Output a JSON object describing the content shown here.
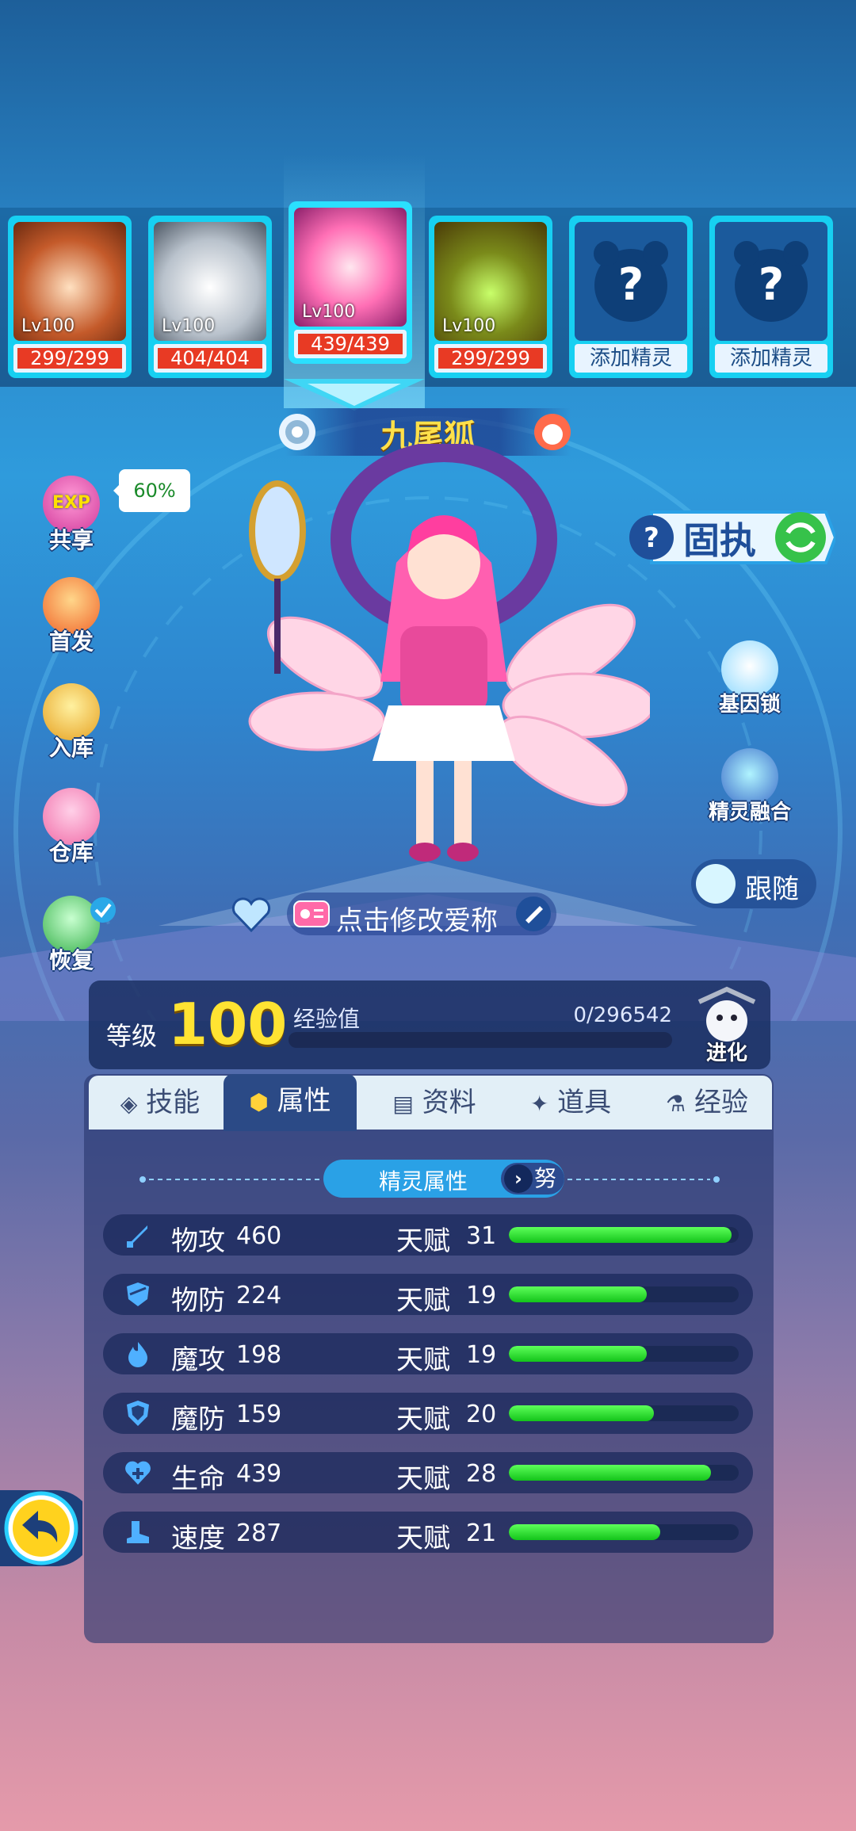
{
  "team": [
    {
      "level": "Lv100",
      "hp": "299/299"
    },
    {
      "level": "Lv100",
      "hp": "404/404"
    },
    {
      "level": "Lv100",
      "hp": "439/439",
      "selected": true
    },
    {
      "level": "Lv100",
      "hp": "299/299"
    },
    {
      "add_label": "添加精灵"
    },
    {
      "add_label": "添加精灵"
    }
  ],
  "pet": {
    "name": "九尾狐",
    "nickname_prompt": "点击修改爱称",
    "trait": "固执",
    "follow_label": "跟随"
  },
  "left_menu": {
    "exp_share": {
      "label": "共享",
      "badge": "EXP",
      "percent": "60%"
    },
    "first": {
      "label": "首发"
    },
    "store": {
      "label": "入库"
    },
    "warehouse": {
      "label": "仓库"
    },
    "heal": {
      "label": "恢复"
    }
  },
  "right_menu": {
    "gene_lock": "基因锁",
    "fusion": "精灵融合"
  },
  "level": {
    "label": "等级",
    "value": "100",
    "exp_label": "经验值",
    "exp_value": "0/296542",
    "exp_progress": 0,
    "evolve_label": "进化"
  },
  "tabs": [
    "技能",
    "属性",
    "资料",
    "道具",
    "经验"
  ],
  "active_tab": 1,
  "attributes": {
    "title": "精灵属性",
    "mode": "努",
    "talent_label": "天赋",
    "rows": [
      {
        "name": "物攻",
        "value": "460",
        "talent": "31",
        "talent_fill": 0.97
      },
      {
        "name": "物防",
        "value": "224",
        "talent": "19",
        "talent_fill": 0.6
      },
      {
        "name": "魔攻",
        "value": "198",
        "talent": "19",
        "talent_fill": 0.6
      },
      {
        "name": "魔防",
        "value": "159",
        "talent": "20",
        "talent_fill": 0.63
      },
      {
        "name": "生命",
        "value": "439",
        "talent": "28",
        "talent_fill": 0.88
      },
      {
        "name": "速度",
        "value": "287",
        "talent": "21",
        "talent_fill": 0.66
      }
    ]
  },
  "colors": {
    "accent": "#2aa1e6",
    "gold": "#ffe332",
    "hp": "#e83a24",
    "bar": "#13c41a"
  }
}
